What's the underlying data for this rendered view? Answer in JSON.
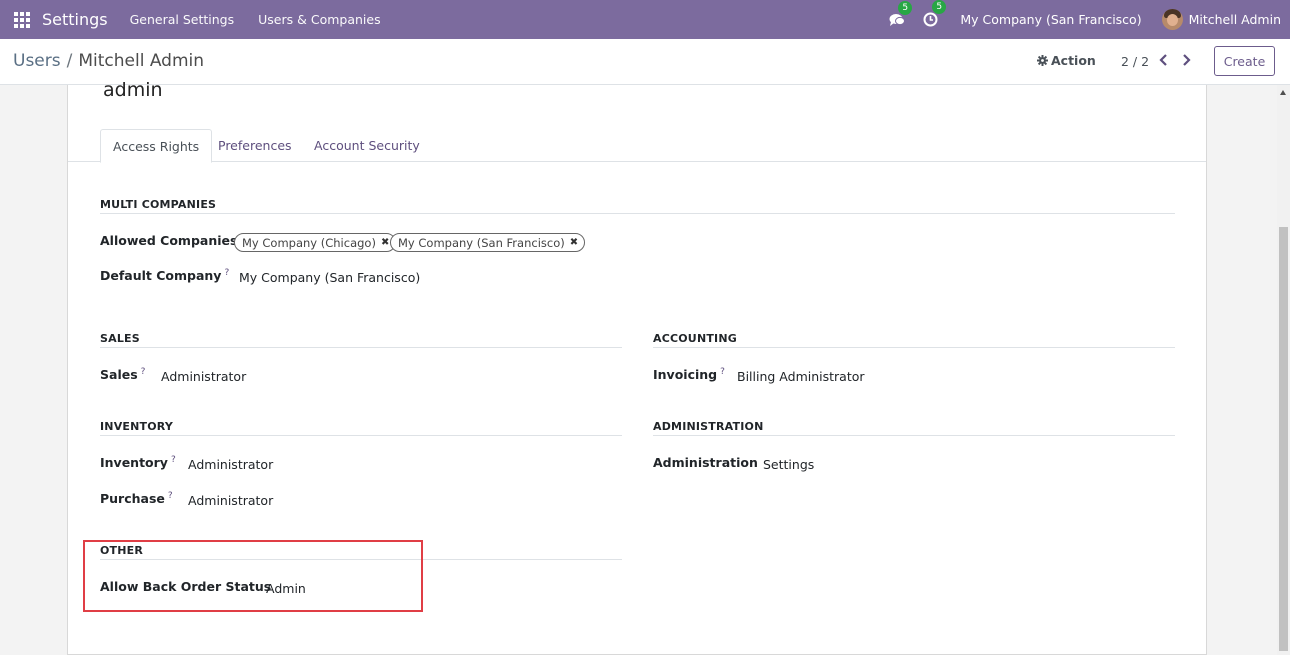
{
  "navbar": {
    "app_name": "Settings",
    "menus": [
      "General Settings",
      "Users & Companies"
    ],
    "messages_count": "5",
    "activities_count": "5",
    "company": "My Company (San Francisco)",
    "user_name": "Mitchell Admin",
    "color": "#7c6b9e"
  },
  "control_panel": {
    "breadcrumb_parent": "Users",
    "breadcrumb_separator": "/",
    "breadcrumb_current": "Mitchell Admin",
    "action_label": "Action",
    "pager": "2 / 2",
    "create_label": "Create"
  },
  "form": {
    "login": "admin",
    "tabs": [
      "Access Rights",
      "Preferences",
      "Account Security"
    ],
    "active_tab": "Access Rights",
    "multi_companies": {
      "title": "MULTI COMPANIES",
      "allowed_companies_label": "Allowed Companies",
      "allowed_companies": [
        "My Company (Chicago)",
        "My Company (San Francisco)"
      ],
      "default_company_label": "Default Company",
      "default_company": "My Company (San Francisco)"
    },
    "sales": {
      "title": "SALES",
      "label": "Sales",
      "value": "Administrator"
    },
    "accounting": {
      "title": "ACCOUNTING",
      "label": "Invoicing",
      "value": "Billing Administrator"
    },
    "inventory": {
      "title": "INVENTORY",
      "inventory_label": "Inventory",
      "inventory_value": "Administrator",
      "purchase_label": "Purchase",
      "purchase_value": "Administrator"
    },
    "administration": {
      "title": "ADMINISTRATION",
      "label": "Administration",
      "value": "Settings"
    },
    "other": {
      "title": "OTHER",
      "label": "Allow Back Order Status",
      "value": "Admin"
    },
    "help_marker": "?",
    "highlight_color": "#e03e45"
  }
}
